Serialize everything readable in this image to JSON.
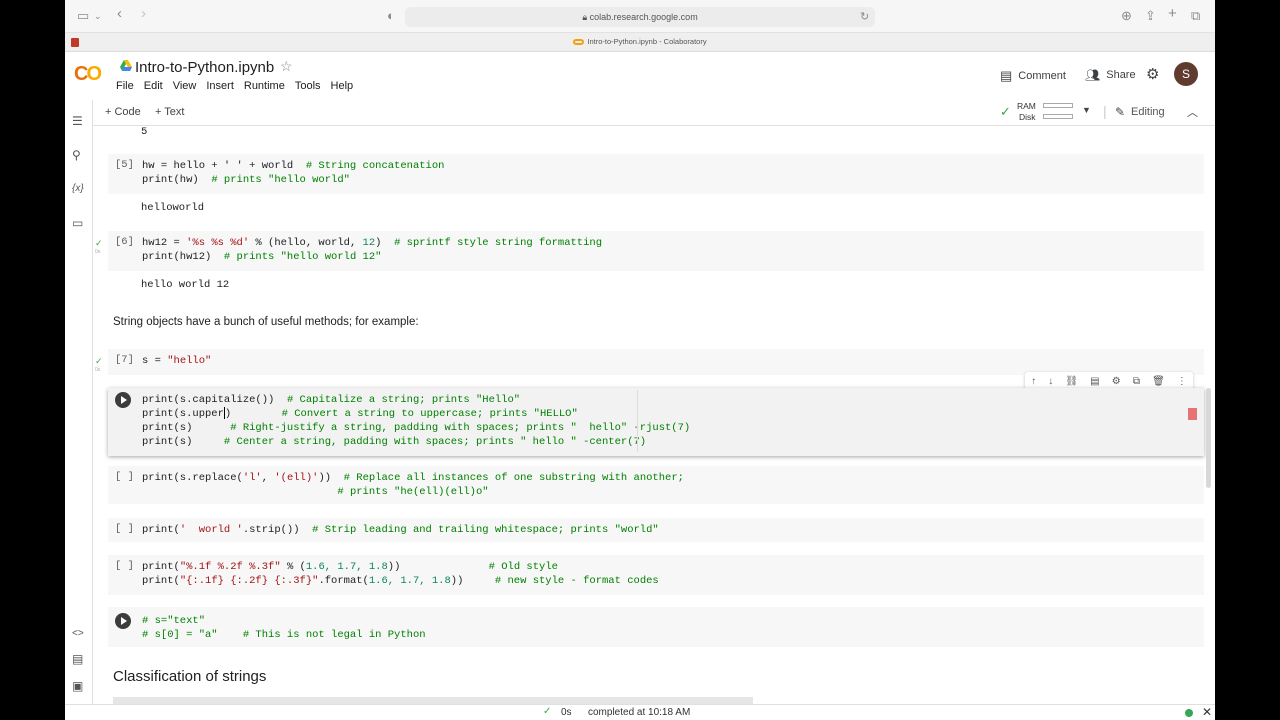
{
  "browser": {
    "url": "colab.research.google.com",
    "tab_title": "Intro-to-Python.ipynb - Colaboratory"
  },
  "header": {
    "logo": "CO",
    "notebook_title": "Intro-to-Python.ipynb",
    "menu": [
      "File",
      "Edit",
      "View",
      "Insert",
      "Runtime",
      "Tools",
      "Help"
    ],
    "comment_label": "Comment",
    "share_label": "Share",
    "avatar_letter": "S"
  },
  "toolbar": {
    "add_code": "+ Code",
    "add_text": "+ Text",
    "ram_label": "RAM",
    "disk_label": "Disk",
    "editing_label": "Editing"
  },
  "cells": {
    "prev_output": "5",
    "c5": {
      "prompt": "[5]",
      "line1_code": "hw = hello + ' ' + world  ",
      "line1_comment": "# String concatenation",
      "line2_code": "print(hw)  ",
      "line2_comment": "# prints \"hello world\"",
      "output": "helloworld"
    },
    "c6": {
      "prompt": "[6]",
      "line1_code": "hw12 = ",
      "line1_str": "'%s %s %d'",
      "line1_rest": " % (hello, world, ",
      "line1_num": "12",
      "line1_close": ")  ",
      "line1_comment": "# sprintf style string formatting",
      "line2_code": "print(hw12)  ",
      "line2_comment": "# prints \"hello world 12\"",
      "output": "hello world 12",
      "exec_time": "0s"
    },
    "md1": "String objects have a bunch of useful methods; for example:",
    "c7": {
      "prompt": "[7]",
      "code": "s = ",
      "str": "\"hello\"",
      "exec_time": "0s"
    },
    "active": {
      "line1_code": "print(s.capitalize())  ",
      "line1_comment": "# Capitalize a string; prints \"Hello\"",
      "line2_code": "print(s.upper",
      "line2_after": ")        ",
      "line2_comment": "# Convert a string to uppercase; prints \"HELLO\"",
      "line3_code": "print(s)      ",
      "line3_comment": "# Right-justify a string, padding with spaces; prints \"  hello\" -rjust(7)",
      "line4_code": "print(s)     ",
      "line4_comment": "# Center a string, padding with spaces; prints \" hello \" -center(7)"
    },
    "c_replace": {
      "prompt": "[ ]",
      "line1_code": "print(s.replace(",
      "line1_str1": "'l'",
      "line1_mid": ", ",
      "line1_str2": "'(ell)'",
      "line1_close": "))  ",
      "line1_comment": "# Replace all instances of one substring with another;",
      "line2_pad": "                               ",
      "line2_comment": "# prints \"he(ell)(ell)o\""
    },
    "c_strip": {
      "prompt": "[ ]",
      "code": "print(",
      "str": "'  world '",
      "rest": ".strip())  ",
      "comment": "# Strip leading and trailing whitespace; prints \"world\""
    },
    "c_format": {
      "prompt": "[ ]",
      "line1_code": "print(",
      "line1_str": "\"%.1f %.2f %.3f\"",
      "line1_rest": " % (",
      "line1_nums": "1.6, 1.7, 1.8",
      "line1_close": "))              ",
      "line1_comment": "# Old style",
      "line2_code": "print(",
      "line2_str": "\"{:.1f} {:.2f} {:.3f}\"",
      "line2_rest": ".format(",
      "line2_nums": "1.6, 1.7, 1.8",
      "line2_close": "))     ",
      "line2_comment": "# new style - format codes"
    },
    "c_legal": {
      "line1": "# s=\"text\"",
      "line2": "# s[0] = \"a\"    # This is not legal in Python"
    },
    "heading": "Classification of strings"
  },
  "status": {
    "time": "0s",
    "message": "completed at 10:18 AM"
  }
}
